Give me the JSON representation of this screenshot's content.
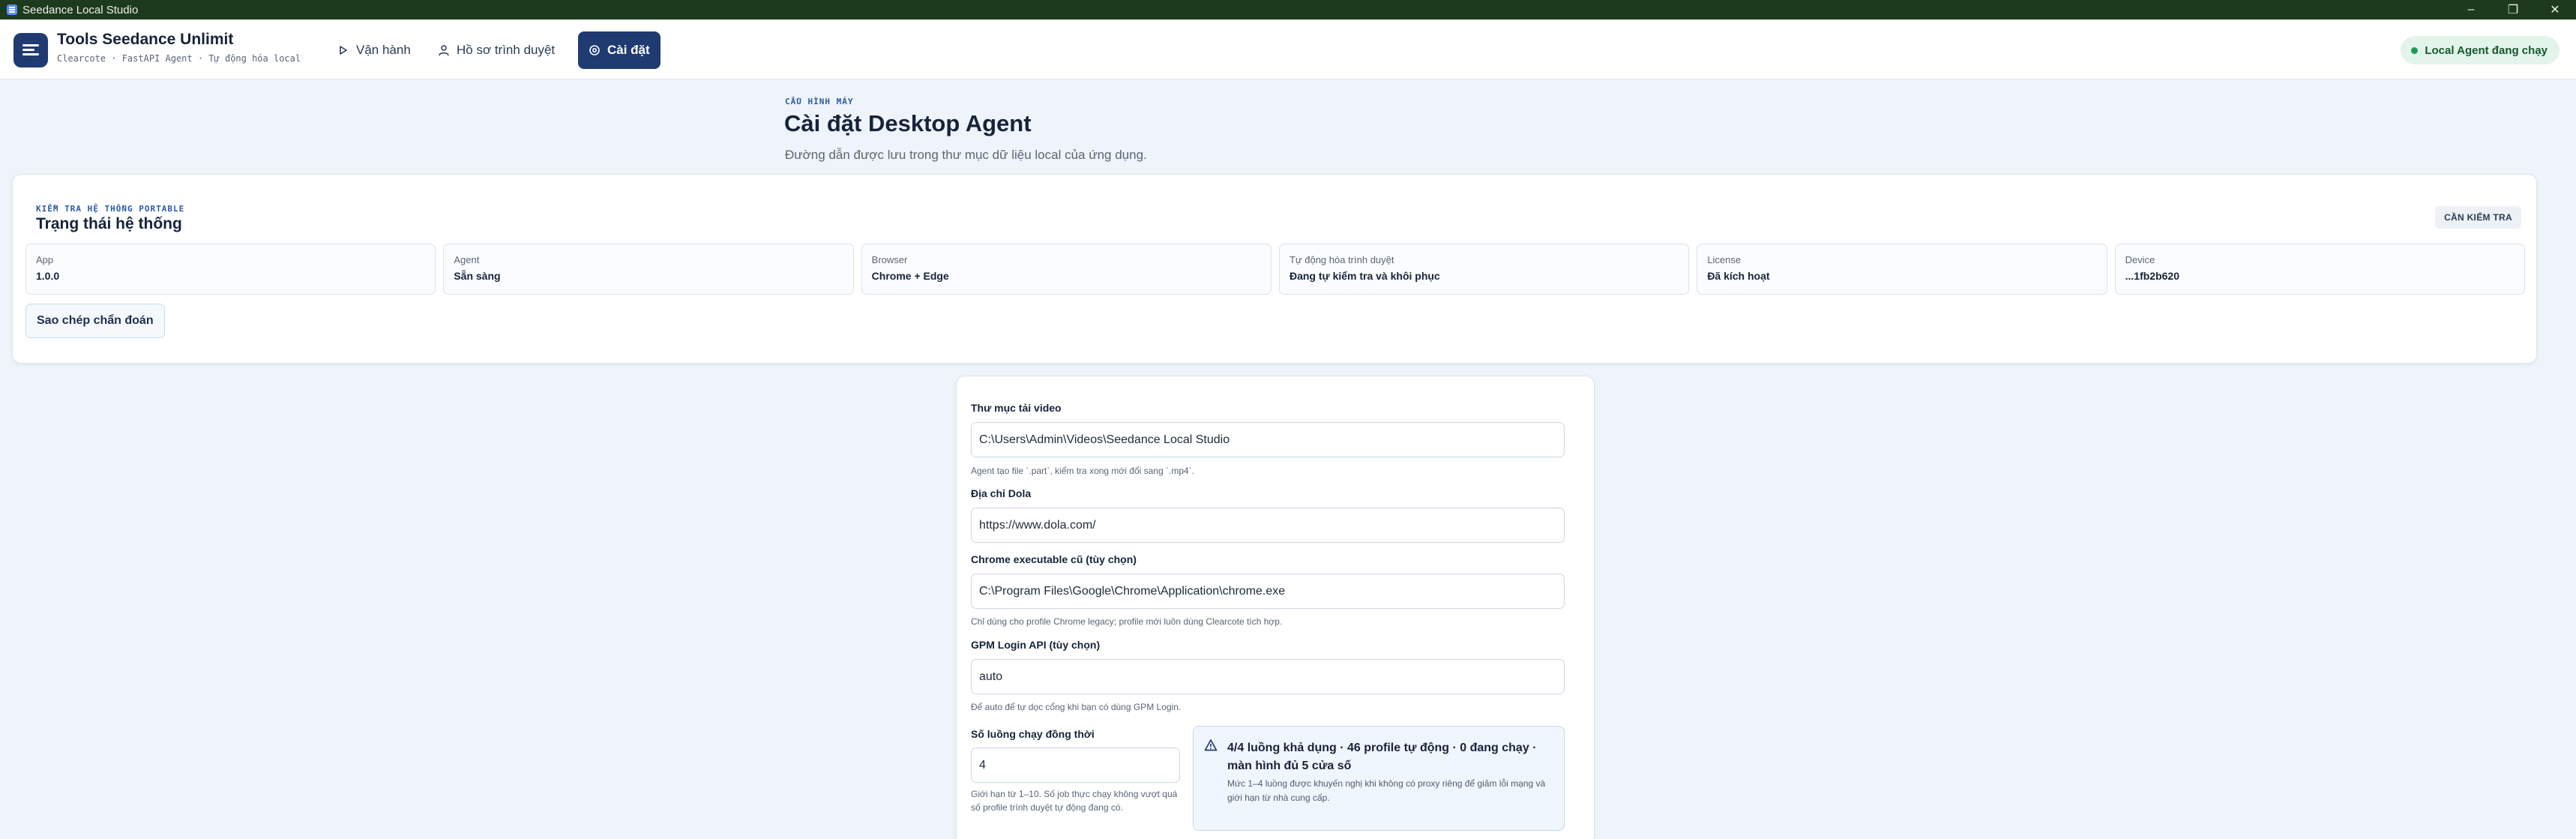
{
  "window": {
    "title": "Seedance Local Studio"
  },
  "header": {
    "brand_title": "Tools Seedance Unlimit",
    "brand_subtitle": "Clearcote · FastAPI Agent · Tự động hóa local",
    "nav": [
      {
        "label": "Vận hành",
        "icon": "play-icon"
      },
      {
        "label": "Hồ sơ trình duyệt",
        "icon": "user-icon"
      },
      {
        "label": "Cài đặt",
        "icon": "settings-icon",
        "active": true
      }
    ],
    "agent_status": "Local Agent đang chạy"
  },
  "page": {
    "eyebrow": "CẤU HÌNH MÁY",
    "title": "Cài đặt Desktop Agent",
    "description": "Đường dẫn được lưu trong thư mục dữ liệu local của ứng dụng."
  },
  "system": {
    "eyebrow": "KIỂM TRA HỆ THỐNG PORTABLE",
    "title": "Trạng thái hệ thống",
    "badge": "CẦN KIỂM TRA",
    "tiles": [
      {
        "label": "App",
        "value": "1.0.0"
      },
      {
        "label": "Agent",
        "value": "Sẵn sàng"
      },
      {
        "label": "Browser",
        "value": "Chrome + Edge"
      },
      {
        "label": "Tự động hóa trình duyệt",
        "value": "Đang tự kiểm tra và khôi phục"
      },
      {
        "label": "License",
        "value": "Đã kích hoạt"
      },
      {
        "label": "Device",
        "value": "...1fb2b620"
      }
    ],
    "copy_button": "Sao chép chẩn đoán"
  },
  "form": {
    "video_dir": {
      "label": "Thư mục tải video",
      "value": "C:\\Users\\Admin\\Videos\\Seedance Local Studio",
      "hint": "Agent tạo file `.part`, kiểm tra xong mới đổi sang `.mp4`."
    },
    "dola": {
      "label": "Địa chỉ Dola",
      "value": "https://www.dola.com/"
    },
    "chrome": {
      "label": "Chrome executable cũ (tùy chọn)",
      "value": "C:\\Program Files\\Google\\Chrome\\Application\\chrome.exe",
      "hint": "Chỉ dùng cho profile Chrome legacy; profile mới luôn dùng Clearcote tích hợp."
    },
    "gpm": {
      "label": "GPM Login API (tùy chọn)",
      "value": "auto",
      "hint": "Để auto để tự dọc cổng khi bạn có dùng GPM Login."
    },
    "concurrency": {
      "label": "Số luồng chạy đồng thời",
      "value": "4",
      "hint": "Giới hạn từ 1–10. Số job thực chạy không vượt quá số profile trình duyệt tự động đang có."
    },
    "info": {
      "title": "4/4 luồng khả dụng · 46 profile tự động · 0 đang chạy · màn hình đủ 5 cửa số",
      "text": "Mức 1–4 luồng được khuyến nghị khi không có proxy riêng để giảm lỗi mạng và giới hạn từ nhà cung cấp."
    }
  },
  "colors": {
    "accent": "#1f3b72",
    "titlebar": "#1e3a1e",
    "status_green": "#1e9b55",
    "page_bg": "#eef4fa"
  }
}
